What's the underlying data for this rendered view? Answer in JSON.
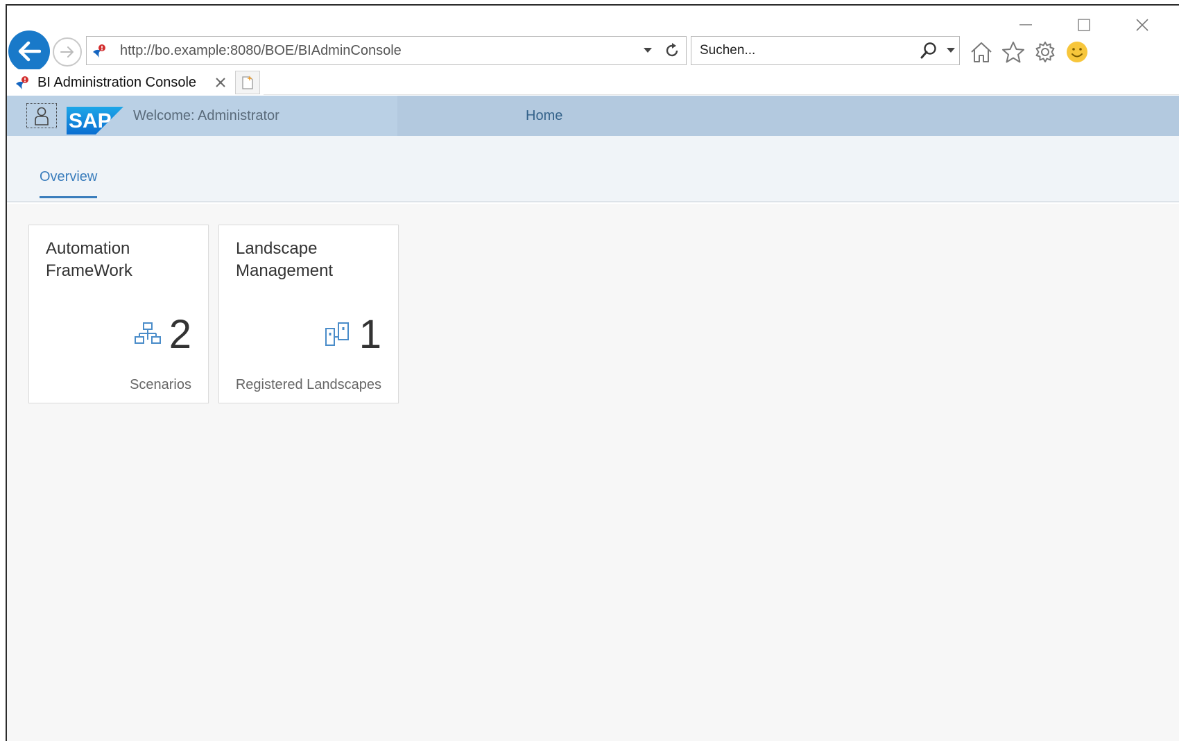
{
  "browser": {
    "address_url": "http://bo.example:8080/BOE/BIAdminConsole",
    "search_placeholder": "Suchen...",
    "tab_title": "BI Administration Console"
  },
  "app": {
    "welcome_text": "Welcome: Administrator",
    "home_label": "Home",
    "logo_text": "SAP",
    "brand_color": "#0a6ed1",
    "header_color": "#bad0e5"
  },
  "tabs": [
    {
      "label": "Overview",
      "selected": true
    }
  ],
  "tiles": [
    {
      "title": "Automation FrameWork",
      "value": "2",
      "footer": "Scenarios",
      "icon": "hierarchy-icon"
    },
    {
      "title": "Landscape Management",
      "value": "1",
      "footer": "Registered Landscapes",
      "icon": "landscape-icon"
    }
  ]
}
